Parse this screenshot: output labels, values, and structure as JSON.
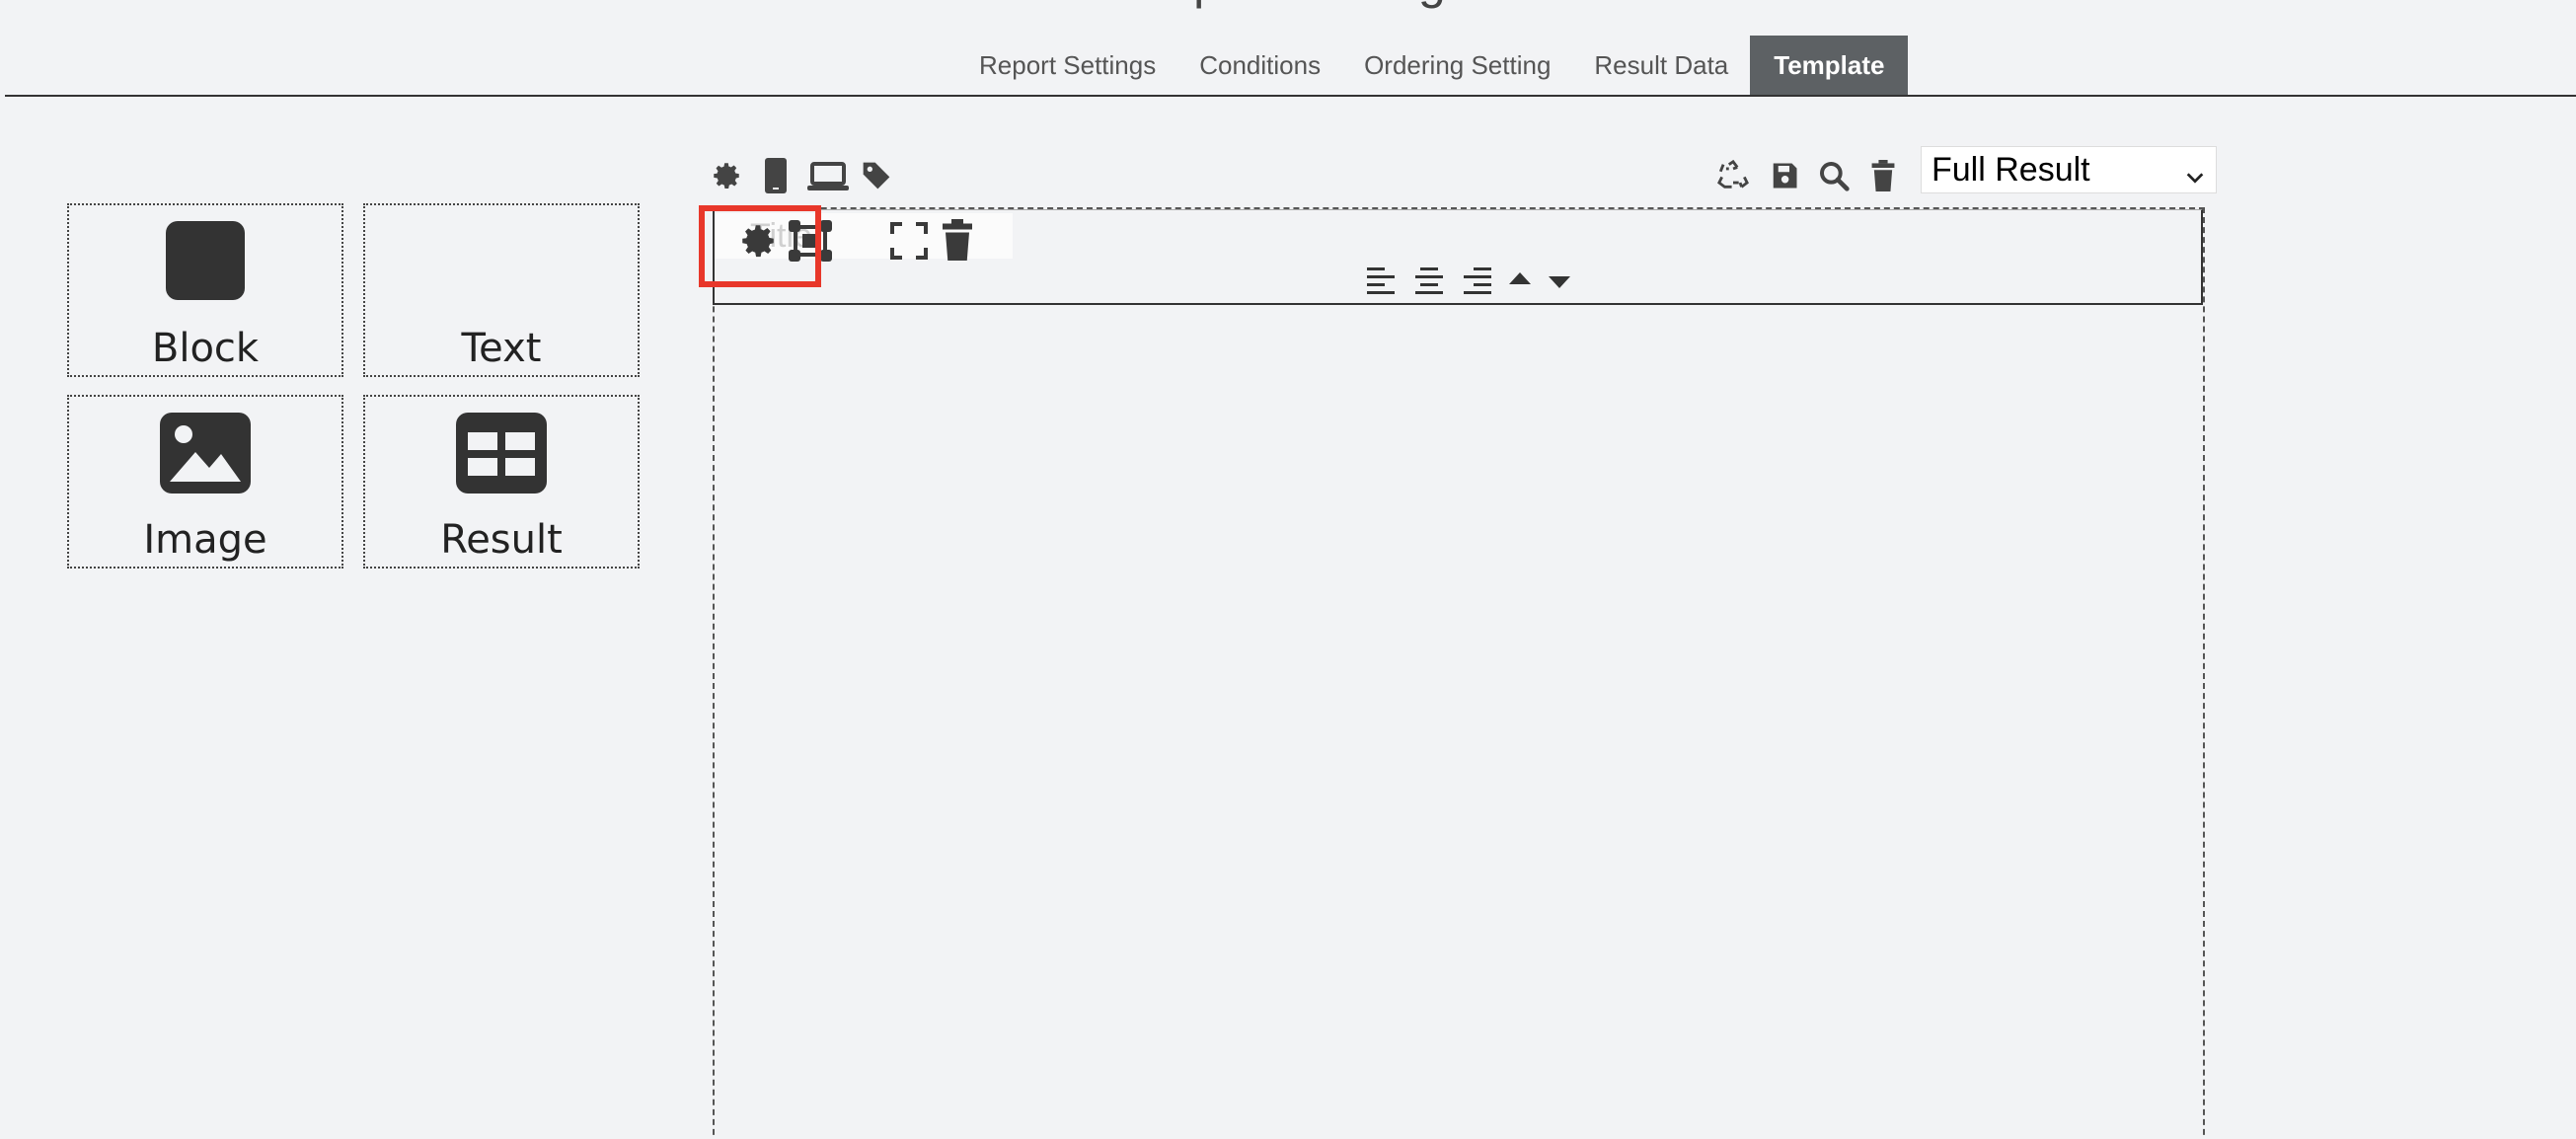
{
  "header": {
    "heading": "Report Setting",
    "tabs": [
      {
        "label": "Report Settings",
        "active": false
      },
      {
        "label": "Conditions",
        "active": false
      },
      {
        "label": "Ordering Setting",
        "active": false
      },
      {
        "label": "Result Data",
        "active": false
      },
      {
        "label": "Template",
        "active": true
      }
    ]
  },
  "palette": {
    "widgets": [
      {
        "label": "Block",
        "icon": "square-icon"
      },
      {
        "label": "Text",
        "icon": ""
      },
      {
        "label": "Image",
        "icon": "image-icon"
      },
      {
        "label": "Result",
        "icon": "table-icon"
      }
    ]
  },
  "editor": {
    "left_tools": [
      "gear-icon",
      "mobile-icon",
      "laptop-icon",
      "tag-icon"
    ],
    "right_tools": [
      "recycle-icon",
      "save-icon",
      "search-icon",
      "trash-icon"
    ],
    "template_select": {
      "value": "Full Result"
    },
    "block_toolbar": {
      "tools": [
        "gear-icon",
        "resize-frame-icon",
        "expand-icon",
        "trash-icon"
      ],
      "ghost_text": "Title"
    },
    "align_tools": [
      "align-left-icon",
      "align-center-icon",
      "align-right-icon",
      "move-up-icon",
      "move-down-icon"
    ]
  },
  "colors": {
    "accent": "#5d6164",
    "highlight": "#e8372a",
    "icon": "#444444",
    "background": "#f2f3f5"
  }
}
